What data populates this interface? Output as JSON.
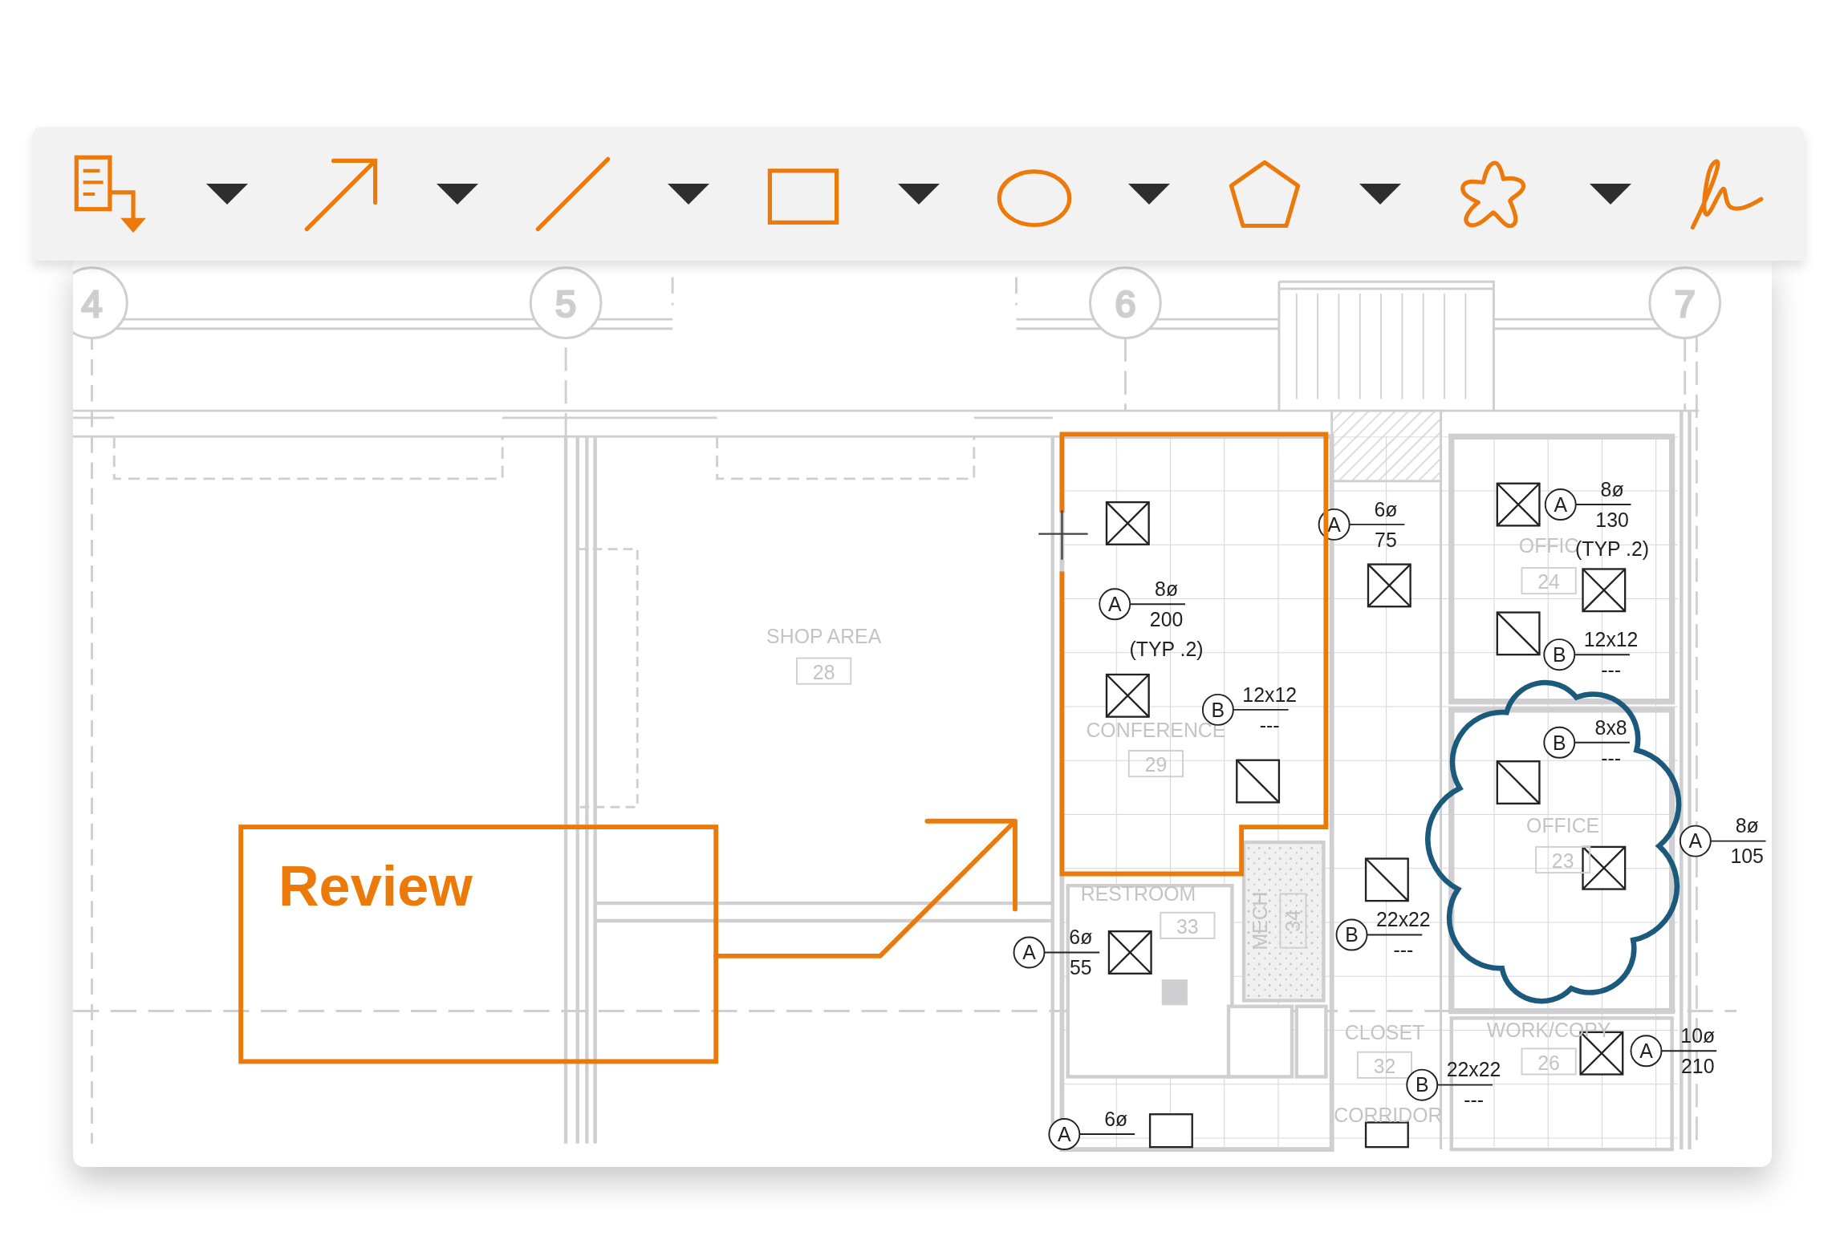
{
  "toolbar": {
    "tools": [
      {
        "kind": "note",
        "dropdown": true
      },
      {
        "kind": "arrow",
        "dropdown": true
      },
      {
        "kind": "line",
        "dropdown": true
      },
      {
        "kind": "rectangle",
        "dropdown": true
      },
      {
        "kind": "ellipse",
        "dropdown": true
      },
      {
        "kind": "polygon",
        "dropdown": true
      },
      {
        "kind": "cloud",
        "dropdown": true
      },
      {
        "kind": "freehand",
        "dropdown": false
      }
    ]
  },
  "plan": {
    "grid_bubbles": [
      "4",
      "5",
      "6",
      "7"
    ],
    "rooms": [
      {
        "name": "SHOP AREA",
        "number": "28"
      },
      {
        "name": "CONFERENCE",
        "number": "29"
      },
      {
        "name": "OFFIC",
        "number": "24"
      },
      {
        "name": "OFFICE",
        "number": "23"
      },
      {
        "name": "RESTROOM",
        "number": "33"
      },
      {
        "name": "MECH",
        "number": "34"
      },
      {
        "name": "CLOSET",
        "number": "32"
      },
      {
        "name": "WORK/COPY",
        "number": "26"
      },
      {
        "name": "CORRIDOR"
      }
    ],
    "tags": [
      {
        "letter": "A",
        "size": "8ø",
        "flow": "200",
        "note": "(TYP .2)"
      },
      {
        "letter": "B",
        "size": "12x12",
        "flow": "---"
      },
      {
        "letter": "A",
        "size": "6ø",
        "flow": "75"
      },
      {
        "letter": "A",
        "size": "8ø",
        "flow": "130",
        "note": "(TYP .2)"
      },
      {
        "letter": "B",
        "size": "12x12",
        "flow": "---"
      },
      {
        "letter": "B",
        "size": "8x8",
        "flow": "---"
      },
      {
        "letter": "A",
        "size": "8ø",
        "flow": "105"
      },
      {
        "letter": "B",
        "size": "22x22",
        "flow": "---"
      },
      {
        "letter": "A",
        "size": "6ø",
        "flow": "55"
      },
      {
        "letter": "B",
        "size": "22x22",
        "flow": "---"
      },
      {
        "letter": "A",
        "size": "10ø",
        "flow": "210"
      },
      {
        "letter": "A",
        "size": "6ø"
      }
    ]
  },
  "markups": [
    {
      "kind": "callout",
      "text": "Review",
      "color": "#ec7a0a"
    },
    {
      "kind": "polygon",
      "color": "#ec7a0a"
    },
    {
      "kind": "cloud",
      "color": "#1c5a7c"
    }
  ]
}
